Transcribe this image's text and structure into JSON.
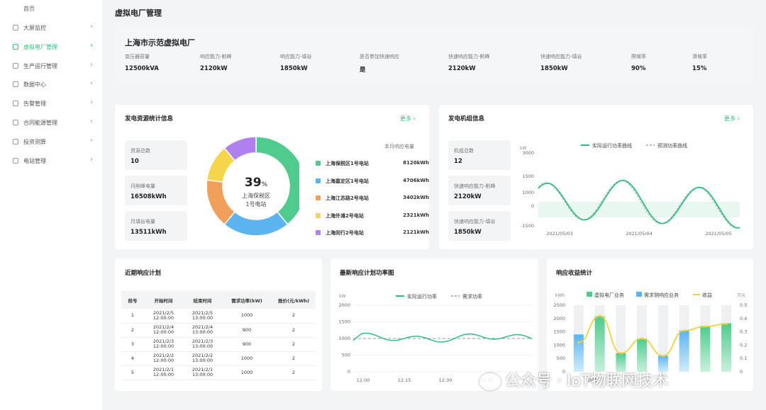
{
  "sidebar": {
    "top_label": "首页",
    "items": [
      {
        "label": "大屏监控",
        "icon": "monitor-icon"
      },
      {
        "label": "虚拟电厂管理",
        "icon": "power-plant-icon",
        "active": true
      },
      {
        "label": "生产运行管理",
        "icon": "production-icon"
      },
      {
        "label": "数据中心",
        "icon": "data-icon"
      },
      {
        "label": "告警管理",
        "icon": "alarm-icon"
      },
      {
        "label": "合同能源管理",
        "icon": "contract-icon"
      },
      {
        "label": "投资测算",
        "icon": "investment-icon"
      },
      {
        "label": "电站管理",
        "icon": "station-icon"
      }
    ]
  },
  "page": {
    "title": "虚拟电厂管理"
  },
  "plant": {
    "name": "上海市示范虚拟电厂",
    "stats": [
      {
        "label": "变压器容量",
        "value": "12500kVA"
      },
      {
        "label": "响应能力-削峰",
        "value": "2120kW"
      },
      {
        "label": "响应能力-填谷",
        "value": "1850kW"
      },
      {
        "label": "是否参加快速响应",
        "value": "是"
      },
      {
        "label": "快速响应能力-削峰",
        "value": "2120kW"
      },
      {
        "label": "快速响应能力-填谷",
        "value": "1850kW"
      },
      {
        "label": "爬坡率",
        "value": "90%"
      },
      {
        "label": "滑坡率",
        "value": "15%"
      }
    ]
  },
  "resources": {
    "title": "发电资源统计信息",
    "more": "更多 ›",
    "kpis": [
      {
        "label": "资源总数",
        "value": "10"
      },
      {
        "label": "月削峰电量",
        "value": "16508kWh"
      },
      {
        "label": "月填谷电量",
        "value": "13511kWh"
      }
    ],
    "donut_percent": "39",
    "donut_percent_unit": "%",
    "donut_label_line1": "上海保税区",
    "donut_label_line2": "1号电站",
    "list_header": "本月响应电量",
    "stations": [
      {
        "name": "上海保税区1号电站",
        "value": "8120kWh",
        "color": "#4ecb8d",
        "share": 39
      },
      {
        "name": "上海嘉定区1号电站",
        "value": "4706kWh",
        "color": "#5bb4f0",
        "share": 22
      },
      {
        "name": "上海江苏路2号电站",
        "value": "3402kWh",
        "color": "#f0a05a",
        "share": 16
      },
      {
        "name": "上海外滩2号电站",
        "value": "2321kWh",
        "color": "#f5d54a",
        "share": 12
      },
      {
        "name": "上海闵行2号电站",
        "value": "2121kWh",
        "color": "#b07ff0",
        "share": 11
      }
    ]
  },
  "units": {
    "title": "发电机组信息",
    "more": "更多 ›",
    "kpis": [
      {
        "label": "机组总数",
        "value": "12"
      },
      {
        "label": "快速响应能力-削峰",
        "value": "2120kW"
      },
      {
        "label": "快速响应能力-填谷",
        "value": "1850kW"
      }
    ],
    "chart_data": {
      "type": "line",
      "ylabel": "kW",
      "ylim": [
        -1500,
        3000
      ],
      "yticks": [
        "3000",
        "1500",
        "1000",
        "0",
        "-1500"
      ],
      "xticks": [
        "2021/05/03",
        "2021/05/04",
        "2021/05/05"
      ],
      "legend": [
        "实际运行功率曲线",
        "预测功率曲线"
      ],
      "colors": {
        "actual": "#2cbf80",
        "forecast": "#bbbbbb"
      }
    }
  },
  "schedule": {
    "title": "近期响应计划",
    "headers": [
      "段号",
      "开始时间",
      "结束时间",
      "需求功率(kW)",
      "报价(元/kWh)"
    ],
    "rows": [
      {
        "no": "1",
        "start_date": "2021/2/5",
        "start_time": "12:00:00",
        "end_date": "2021/2/5",
        "end_time": "13:00:00",
        "power": "1000",
        "price": "2"
      },
      {
        "no": "2",
        "start_date": "2021/2/4",
        "start_time": "12:00:00",
        "end_date": "2021/2/4",
        "end_time": "13:00:00",
        "power": "900",
        "price": "2"
      },
      {
        "no": "3",
        "start_date": "2021/2/3",
        "start_time": "12:00:00",
        "end_date": "2021/2/3",
        "end_time": "13:00:00",
        "power": "900",
        "price": "2"
      },
      {
        "no": "4",
        "start_date": "2021/2/2",
        "start_time": "12:00:00",
        "end_date": "2021/2/2",
        "end_time": "13:00:00",
        "power": "1000",
        "price": "2"
      },
      {
        "no": "5",
        "start_date": "2021/2/1",
        "start_time": "12:00:00",
        "end_date": "2021/2/1",
        "end_time": "13:00:00",
        "power": "1000",
        "price": "2"
      }
    ]
  },
  "power_curve": {
    "title": "最新响应计划功率图",
    "chart_data": {
      "type": "line",
      "ylabel": "kW",
      "ylim": [
        0,
        2000
      ],
      "yticks": [
        "2000",
        "1500",
        "1000",
        "500",
        "0"
      ],
      "xticks": [
        "12:00",
        "12:15",
        "12:30",
        "12:45"
      ],
      "legend": [
        "实际运行功率",
        "需求功率"
      ],
      "demand": 1000,
      "colors": {
        "actual": "#2cbf80",
        "demand": "#999999"
      }
    }
  },
  "revenue": {
    "title": "响应收益统计",
    "chart_data": {
      "type": "bar",
      "ylabel_left": "kWh",
      "ylabel_right": "万元",
      "yticks_left": [
        "2500",
        "2000",
        "1500",
        "1000",
        "500",
        "0"
      ],
      "yticks_right": [
        "0.5",
        "0.4",
        "0.3",
        "0.2",
        "0.1",
        "0"
      ],
      "legend": [
        "虚拟电厂业务",
        "需求侧响应业务",
        "收益"
      ],
      "x_label_visible": "段号",
      "series": [
        {
          "name": "虚拟电厂业务",
          "values": [
            0,
            2080,
            700,
            1250,
            0,
            0,
            1720,
            1820
          ]
        },
        {
          "name": "需求侧响应业务",
          "values": [
            1400,
            0,
            0,
            0,
            600,
            1550,
            0,
            0
          ]
        }
      ],
      "line": {
        "name": "收益",
        "values": [
          0.22,
          0.42,
          0.14,
          0.25,
          0.12,
          0.31,
          0.34,
          0.36
        ]
      },
      "colors": {
        "vpp": "#4ecb8d",
        "demand": "#5bb4f0",
        "income": "#f0d23c"
      }
    }
  },
  "watermark": {
    "text": "公众号 · IoT物联网技术"
  }
}
